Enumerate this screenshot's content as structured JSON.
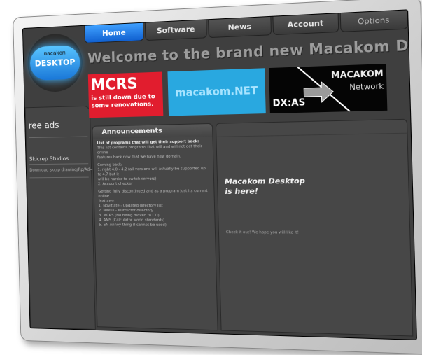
{
  "nav": {
    "tabs": [
      "Home",
      "Software",
      "News",
      "Account",
      "Options"
    ],
    "active": "Home"
  },
  "logo": {
    "top": "macakom",
    "main": "DESKTOP"
  },
  "header": {
    "welcome": "Welcome to the brand new Macakom Desktop!!!"
  },
  "banners": {
    "mcrs": {
      "title": "MCRS",
      "subtitle_1": "is still down due to",
      "subtitle_2": "some renovations."
    },
    "net": {
      "title": "macakom.NET"
    },
    "network": {
      "title": "MACAKOM",
      "subtitle": "Network",
      "label": "DX:AS"
    }
  },
  "sidebar": {
    "ads_title": "ree ads",
    "ad_name": "Skicrep Studios",
    "ad_line": "Download skcrp drawing/Rp/Ad=C"
  },
  "announcements": {
    "title": "Announcements",
    "heading": "List of programs that will get their support back:",
    "intro_1": "This list contains programs that will and will not get their online",
    "intro_2": "features back now that we have new domain.",
    "section_1": "Coming back:",
    "item_1": "1. right 4.0 - 4.2 (all versions will actually be supported up to 4.7 but it",
    "item_1b": "will be harder to switch servers)",
    "item_2": "2. Account checker",
    "section_2": "Getting fully discontinued and as a program just its current online",
    "section_2b": "features:",
    "item_3": "1. Novitiate - Updated directory list",
    "item_4": "2. Nexus - Instructor directory",
    "item_5": "3. MCRS (No being moved to CD)",
    "item_6": "4. AMS (Calculator world standards)",
    "item_7": "5. SN Annoy thing (I cannot be used)"
  },
  "main": {
    "title_1": "Macakom Desktop",
    "title_2": "is here!",
    "sub": "Check it out! We hope you will like it!"
  },
  "colors": {
    "accent": "#1878e0",
    "mcrs_red": "#e11d2e",
    "net_blue": "#29a8e0"
  }
}
